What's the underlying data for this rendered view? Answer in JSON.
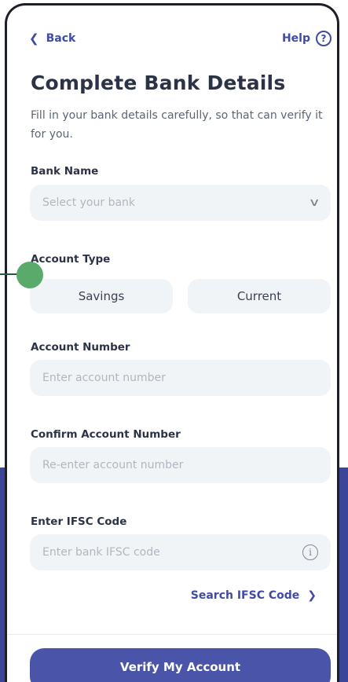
{
  "topbar": {
    "back_label": "Back",
    "help_label": "Help",
    "help_glyph": "?"
  },
  "header": {
    "title": "Complete Bank Details",
    "subtitle": "Fill in your bank details carefully, so that can verify it for you."
  },
  "bank_name": {
    "label": "Bank Name",
    "placeholder": "Select your bank"
  },
  "account_type": {
    "label": "Account Type",
    "options": [
      "Savings",
      "Current"
    ]
  },
  "account_number": {
    "label": "Account Number",
    "placeholder": "Enter account number"
  },
  "confirm_account_number": {
    "label": "Confirm Account Number",
    "placeholder": "Re-enter account number"
  },
  "ifsc": {
    "label": "Enter IFSC Code",
    "placeholder": "Enter bank IFSC code",
    "search_label": "Search IFSC Code"
  },
  "footer": {
    "verify_label": "Verify My Account"
  },
  "colors": {
    "accent": "#4a55aa",
    "link": "#3f4ba5",
    "field_bg": "#f1f4f6",
    "backdrop": "#3b4698",
    "marker": "#5aaa6b"
  },
  "icons": {
    "back": "chevron-left-icon",
    "help": "help-circle-icon",
    "dropdown": "chevron-down-icon",
    "info": "info-icon",
    "search": "chevron-right-icon"
  }
}
